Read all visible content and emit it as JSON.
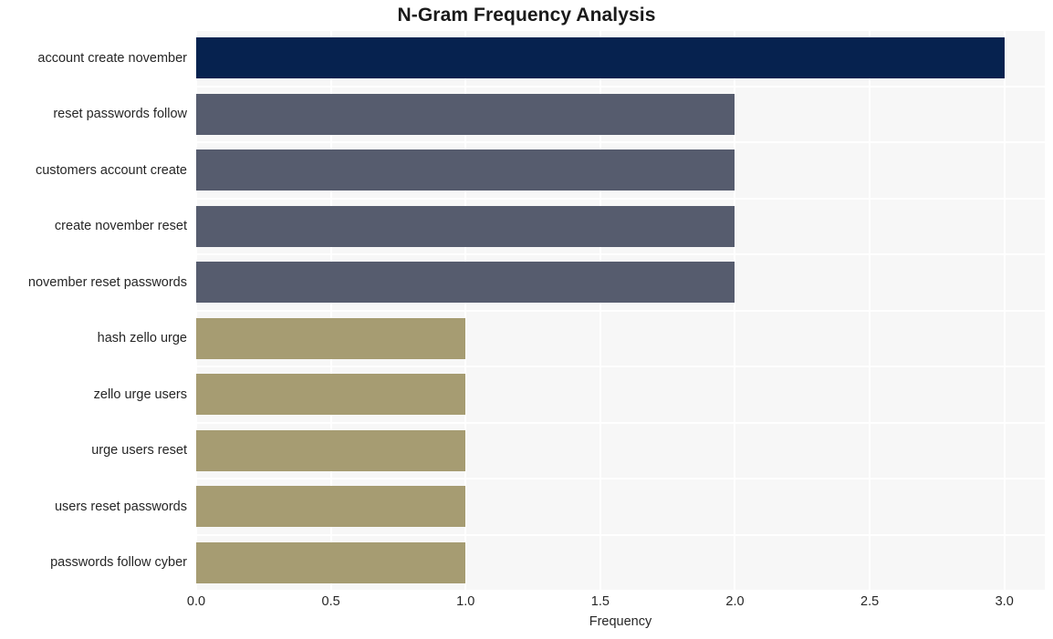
{
  "chart_data": {
    "type": "bar",
    "orientation": "horizontal",
    "title": "N-Gram Frequency Analysis",
    "xlabel": "Frequency",
    "ylabel": "",
    "xlim": [
      0,
      3.15
    ],
    "xticks": [
      0.0,
      0.5,
      1.0,
      1.5,
      2.0,
      2.5,
      3.0
    ],
    "xticklabels": [
      "0.0",
      "0.5",
      "1.0",
      "1.5",
      "2.0",
      "2.5",
      "3.0"
    ],
    "grid": true,
    "legend": null,
    "categories": [
      "account create november",
      "reset passwords follow",
      "customers account create",
      "create november reset",
      "november reset passwords",
      "hash zello urge",
      "zello urge users",
      "urge users reset",
      "users reset passwords",
      "passwords follow cyber"
    ],
    "values": [
      3,
      2,
      2,
      2,
      2,
      1,
      1,
      1,
      1,
      1
    ],
    "bar_colors": [
      "#06224f",
      "#565c6e",
      "#565c6e",
      "#565c6e",
      "#565c6e",
      "#a69c72",
      "#a69c72",
      "#a69c72",
      "#a69c72",
      "#a69c72"
    ]
  },
  "style": {
    "figure_background": "#ffffff",
    "plot_background": "#f7f7f7",
    "grid_color": "#ffffff",
    "title_color": "#1a1a1a",
    "tick_color": "#262626"
  }
}
